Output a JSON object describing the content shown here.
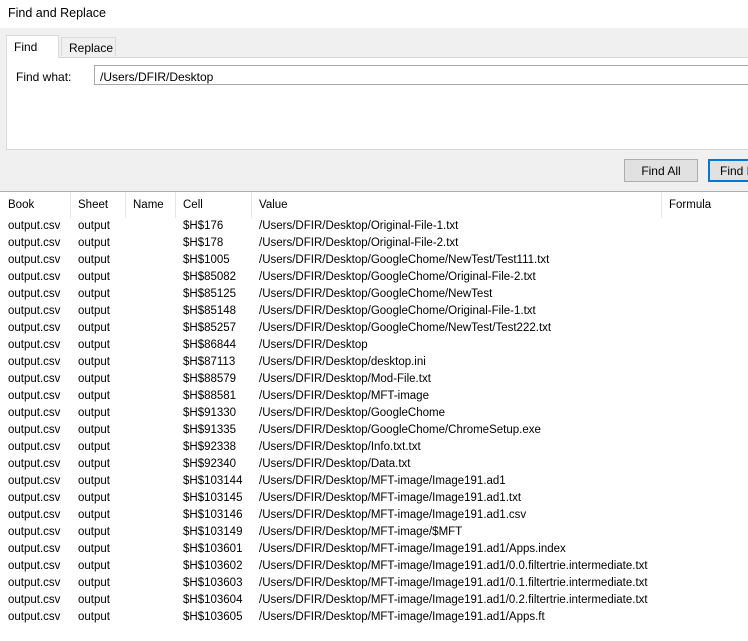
{
  "window": {
    "title": "Find and Replace"
  },
  "tabs": [
    {
      "label": "Find"
    },
    {
      "label": "Replace"
    }
  ],
  "find": {
    "label": "Find what:",
    "value": "/Users/DFIR/Desktop"
  },
  "buttons": {
    "find_all": "Find All",
    "find_next": "Find Next"
  },
  "results": {
    "columns": [
      "Book",
      "Sheet",
      "Name",
      "Cell",
      "Value",
      "Formula"
    ],
    "rows": [
      {
        "book": "output.csv",
        "sheet": "output",
        "name": "",
        "cell": "$H$176",
        "value": "/Users/DFIR/Desktop/Original-File-1.txt",
        "formula": ""
      },
      {
        "book": "output.csv",
        "sheet": "output",
        "name": "",
        "cell": "$H$178",
        "value": "/Users/DFIR/Desktop/Original-File-2.txt",
        "formula": ""
      },
      {
        "book": "output.csv",
        "sheet": "output",
        "name": "",
        "cell": "$H$1005",
        "value": "/Users/DFIR/Desktop/GoogleChome/NewTest/Test111.txt",
        "formula": ""
      },
      {
        "book": "output.csv",
        "sheet": "output",
        "name": "",
        "cell": "$H$85082",
        "value": "/Users/DFIR/Desktop/GoogleChome/Original-File-2.txt",
        "formula": ""
      },
      {
        "book": "output.csv",
        "sheet": "output",
        "name": "",
        "cell": "$H$85125",
        "value": "/Users/DFIR/Desktop/GoogleChome/NewTest",
        "formula": ""
      },
      {
        "book": "output.csv",
        "sheet": "output",
        "name": "",
        "cell": "$H$85148",
        "value": "/Users/DFIR/Desktop/GoogleChome/Original-File-1.txt",
        "formula": ""
      },
      {
        "book": "output.csv",
        "sheet": "output",
        "name": "",
        "cell": "$H$85257",
        "value": "/Users/DFIR/Desktop/GoogleChome/NewTest/Test222.txt",
        "formula": ""
      },
      {
        "book": "output.csv",
        "sheet": "output",
        "name": "",
        "cell": "$H$86844",
        "value": "/Users/DFIR/Desktop",
        "formula": ""
      },
      {
        "book": "output.csv",
        "sheet": "output",
        "name": "",
        "cell": "$H$87113",
        "value": "/Users/DFIR/Desktop/desktop.ini",
        "formula": ""
      },
      {
        "book": "output.csv",
        "sheet": "output",
        "name": "",
        "cell": "$H$88579",
        "value": "/Users/DFIR/Desktop/Mod-File.txt",
        "formula": ""
      },
      {
        "book": "output.csv",
        "sheet": "output",
        "name": "",
        "cell": "$H$88581",
        "value": "/Users/DFIR/Desktop/MFT-image",
        "formula": ""
      },
      {
        "book": "output.csv",
        "sheet": "output",
        "name": "",
        "cell": "$H$91330",
        "value": "/Users/DFIR/Desktop/GoogleChome",
        "formula": ""
      },
      {
        "book": "output.csv",
        "sheet": "output",
        "name": "",
        "cell": "$H$91335",
        "value": "/Users/DFIR/Desktop/GoogleChome/ChromeSetup.exe",
        "formula": ""
      },
      {
        "book": "output.csv",
        "sheet": "output",
        "name": "",
        "cell": "$H$92338",
        "value": "/Users/DFIR/Desktop/Info.txt.txt",
        "formula": ""
      },
      {
        "book": "output.csv",
        "sheet": "output",
        "name": "",
        "cell": "$H$92340",
        "value": "/Users/DFIR/Desktop/Data.txt",
        "formula": ""
      },
      {
        "book": "output.csv",
        "sheet": "output",
        "name": "",
        "cell": "$H$103144",
        "value": "/Users/DFIR/Desktop/MFT-image/Image191.ad1",
        "formula": ""
      },
      {
        "book": "output.csv",
        "sheet": "output",
        "name": "",
        "cell": "$H$103145",
        "value": "/Users/DFIR/Desktop/MFT-image/Image191.ad1.txt",
        "formula": ""
      },
      {
        "book": "output.csv",
        "sheet": "output",
        "name": "",
        "cell": "$H$103146",
        "value": "/Users/DFIR/Desktop/MFT-image/Image191.ad1.csv",
        "formula": ""
      },
      {
        "book": "output.csv",
        "sheet": "output",
        "name": "",
        "cell": "$H$103149",
        "value": "/Users/DFIR/Desktop/MFT-image/$MFT",
        "formula": ""
      },
      {
        "book": "output.csv",
        "sheet": "output",
        "name": "",
        "cell": "$H$103601",
        "value": "/Users/DFIR/Desktop/MFT-image/Image191.ad1/Apps.index",
        "formula": ""
      },
      {
        "book": "output.csv",
        "sheet": "output",
        "name": "",
        "cell": "$H$103602",
        "value": "/Users/DFIR/Desktop/MFT-image/Image191.ad1/0.0.filtertrie.intermediate.txt",
        "formula": ""
      },
      {
        "book": "output.csv",
        "sheet": "output",
        "name": "",
        "cell": "$H$103603",
        "value": "/Users/DFIR/Desktop/MFT-image/Image191.ad1/0.1.filtertrie.intermediate.txt",
        "formula": ""
      },
      {
        "book": "output.csv",
        "sheet": "output",
        "name": "",
        "cell": "$H$103604",
        "value": "/Users/DFIR/Desktop/MFT-image/Image191.ad1/0.2.filtertrie.intermediate.txt",
        "formula": ""
      },
      {
        "book": "output.csv",
        "sheet": "output",
        "name": "",
        "cell": "$H$103605",
        "value": "/Users/DFIR/Desktop/MFT-image/Image191.ad1/Apps.ft",
        "formula": ""
      }
    ]
  }
}
